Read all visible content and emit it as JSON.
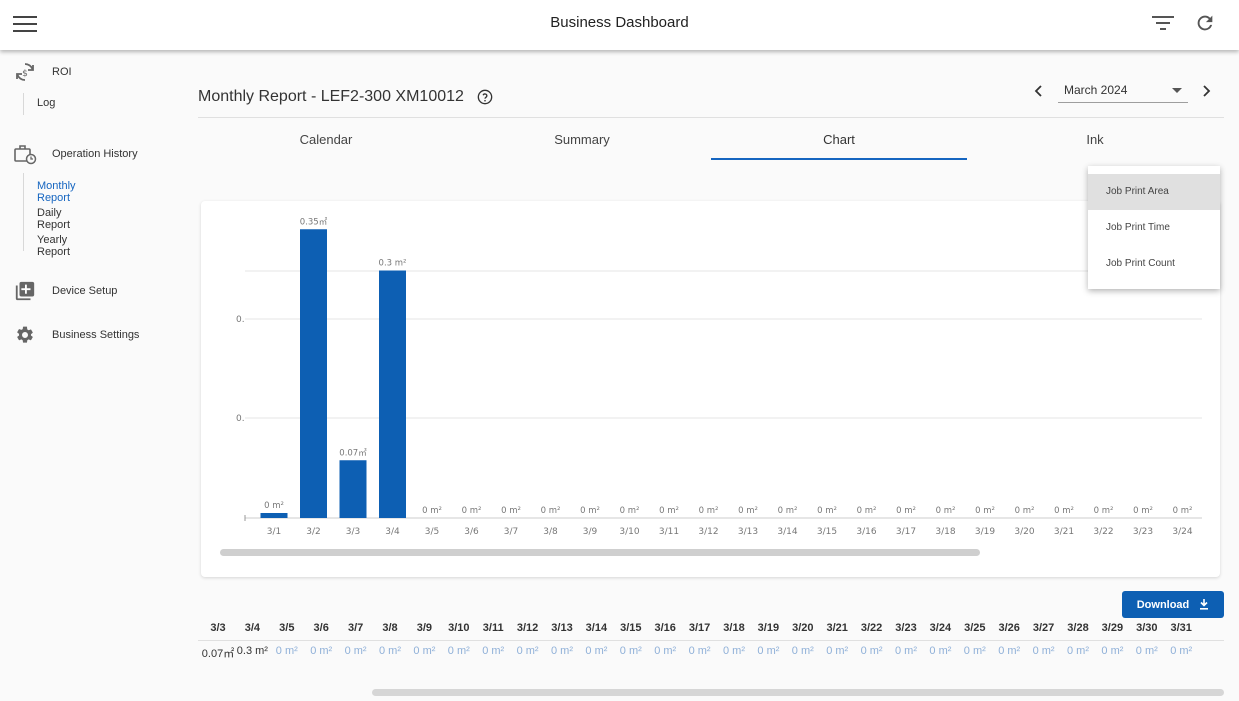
{
  "app": {
    "title": "Business Dashboard"
  },
  "sidebar": {
    "roi": {
      "label": "ROI",
      "icon": "sync-money-icon",
      "children": [
        "Log"
      ]
    },
    "operation_history": {
      "label": "Operation History",
      "icon": "briefcase-clock-icon",
      "children": [
        "Monthly Report",
        "Daily Report",
        "Yearly Report"
      ],
      "active_child": "Monthly Report"
    },
    "device_setup": {
      "label": "Device Setup",
      "icon": "add-box-icon"
    },
    "business_settings": {
      "label": "Business Settings",
      "icon": "gear-icon"
    }
  },
  "header": {
    "report_title": "Monthly Report - LEF2-300 XM10012",
    "month": "March 2024"
  },
  "tabs": [
    {
      "label": "Calendar"
    },
    {
      "label": "Summary"
    },
    {
      "label": "Chart",
      "active": true
    },
    {
      "label": "Ink"
    }
  ],
  "dropdown": {
    "items": [
      "Job Print Area",
      "Job Print Time",
      "Job Print Count"
    ],
    "selected": "Job Print Area"
  },
  "chart_data": {
    "type": "bar",
    "categories": [
      "3/1",
      "3/2",
      "3/3",
      "3/4",
      "3/5",
      "3/6",
      "3/7",
      "3/8",
      "3/9",
      "3/10",
      "3/11",
      "3/12",
      "3/13",
      "3/14",
      "3/15",
      "3/16",
      "3/17",
      "3/18",
      "3/19",
      "3/20",
      "3/21",
      "3/22",
      "3/23",
      "3/24"
    ],
    "values": [
      0.005,
      0.35,
      0.07,
      0.3,
      0,
      0,
      0,
      0,
      0,
      0,
      0,
      0,
      0,
      0,
      0,
      0,
      0,
      0,
      0,
      0,
      0,
      0,
      0,
      0
    ],
    "data_labels": [
      "0 m²",
      "0.35㎡",
      "0.07㎡",
      "0.3 m²",
      "0 m²",
      "0 m²",
      "0 m²",
      "0 m²",
      "0 m²",
      "0 m²",
      "0 m²",
      "0 m²",
      "0 m²",
      "0 m²",
      "0 m²",
      "0 m²",
      "0 m²",
      "0 m²",
      "0 m²",
      "0 m²",
      "0 m²",
      "0 m²",
      "0 m²",
      "0 m²"
    ],
    "ytick_labels": [
      "0.",
      "0.",
      "0."
    ],
    "ylim": [
      0,
      0.36
    ],
    "grid": true,
    "color": "#0d5fb3"
  },
  "download": {
    "label": "Download"
  },
  "table": {
    "headers": [
      "3/3",
      "3/4",
      "3/5",
      "3/6",
      "3/7",
      "3/8",
      "3/9",
      "3/10",
      "3/11",
      "3/12",
      "3/13",
      "3/14",
      "3/15",
      "3/16",
      "3/17",
      "3/18",
      "3/19",
      "3/20",
      "3/21",
      "3/22",
      "3/23",
      "3/24",
      "3/25",
      "3/26",
      "3/27",
      "3/28",
      "3/29",
      "3/30",
      "3/31"
    ],
    "values": [
      "0.07㎡",
      "0.3 m²",
      "0 m²",
      "0 m²",
      "0 m²",
      "0 m²",
      "0 m²",
      "0 m²",
      "0 m²",
      "0 m²",
      "0 m²",
      "0 m²",
      "0 m²",
      "0 m²",
      "0 m²",
      "0 m²",
      "0 m²",
      "0 m²",
      "0 m²",
      "0 m²",
      "0 m²",
      "0 m²",
      "0 m²",
      "0 m²",
      "0 m²",
      "0 m²",
      "0 m²",
      "0 m²",
      "0 m²"
    ]
  }
}
